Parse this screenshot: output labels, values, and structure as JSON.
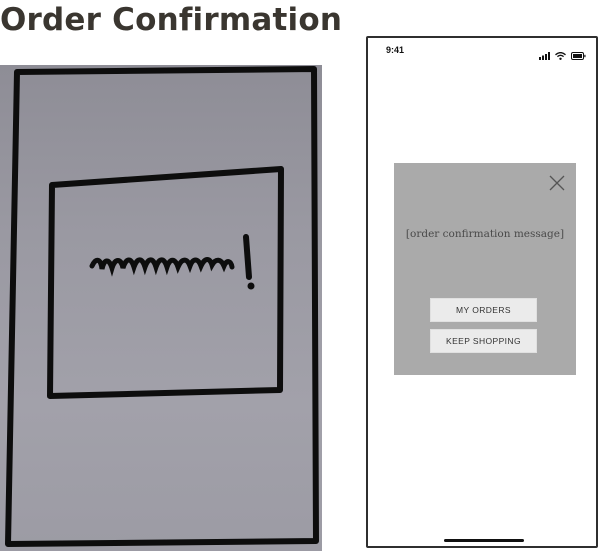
{
  "page": {
    "title": "Order Confirmation"
  },
  "sketch": {
    "scribble_icon": "scribble-exclamation-icon"
  },
  "phone": {
    "status": {
      "time": "9:41",
      "icons": [
        "signal-icon",
        "wifi-icon",
        "battery-icon"
      ]
    },
    "modal": {
      "message": "[order confirmation message]",
      "buttons": {
        "my_orders": "MY ORDERS",
        "keep_shopping": "KEEP SHOPPING"
      },
      "close_icon": "close-icon"
    }
  },
  "colors": {
    "modal_bg": "#aaaaaa",
    "button_bg": "#ebebeb",
    "title": "#3a3630"
  }
}
